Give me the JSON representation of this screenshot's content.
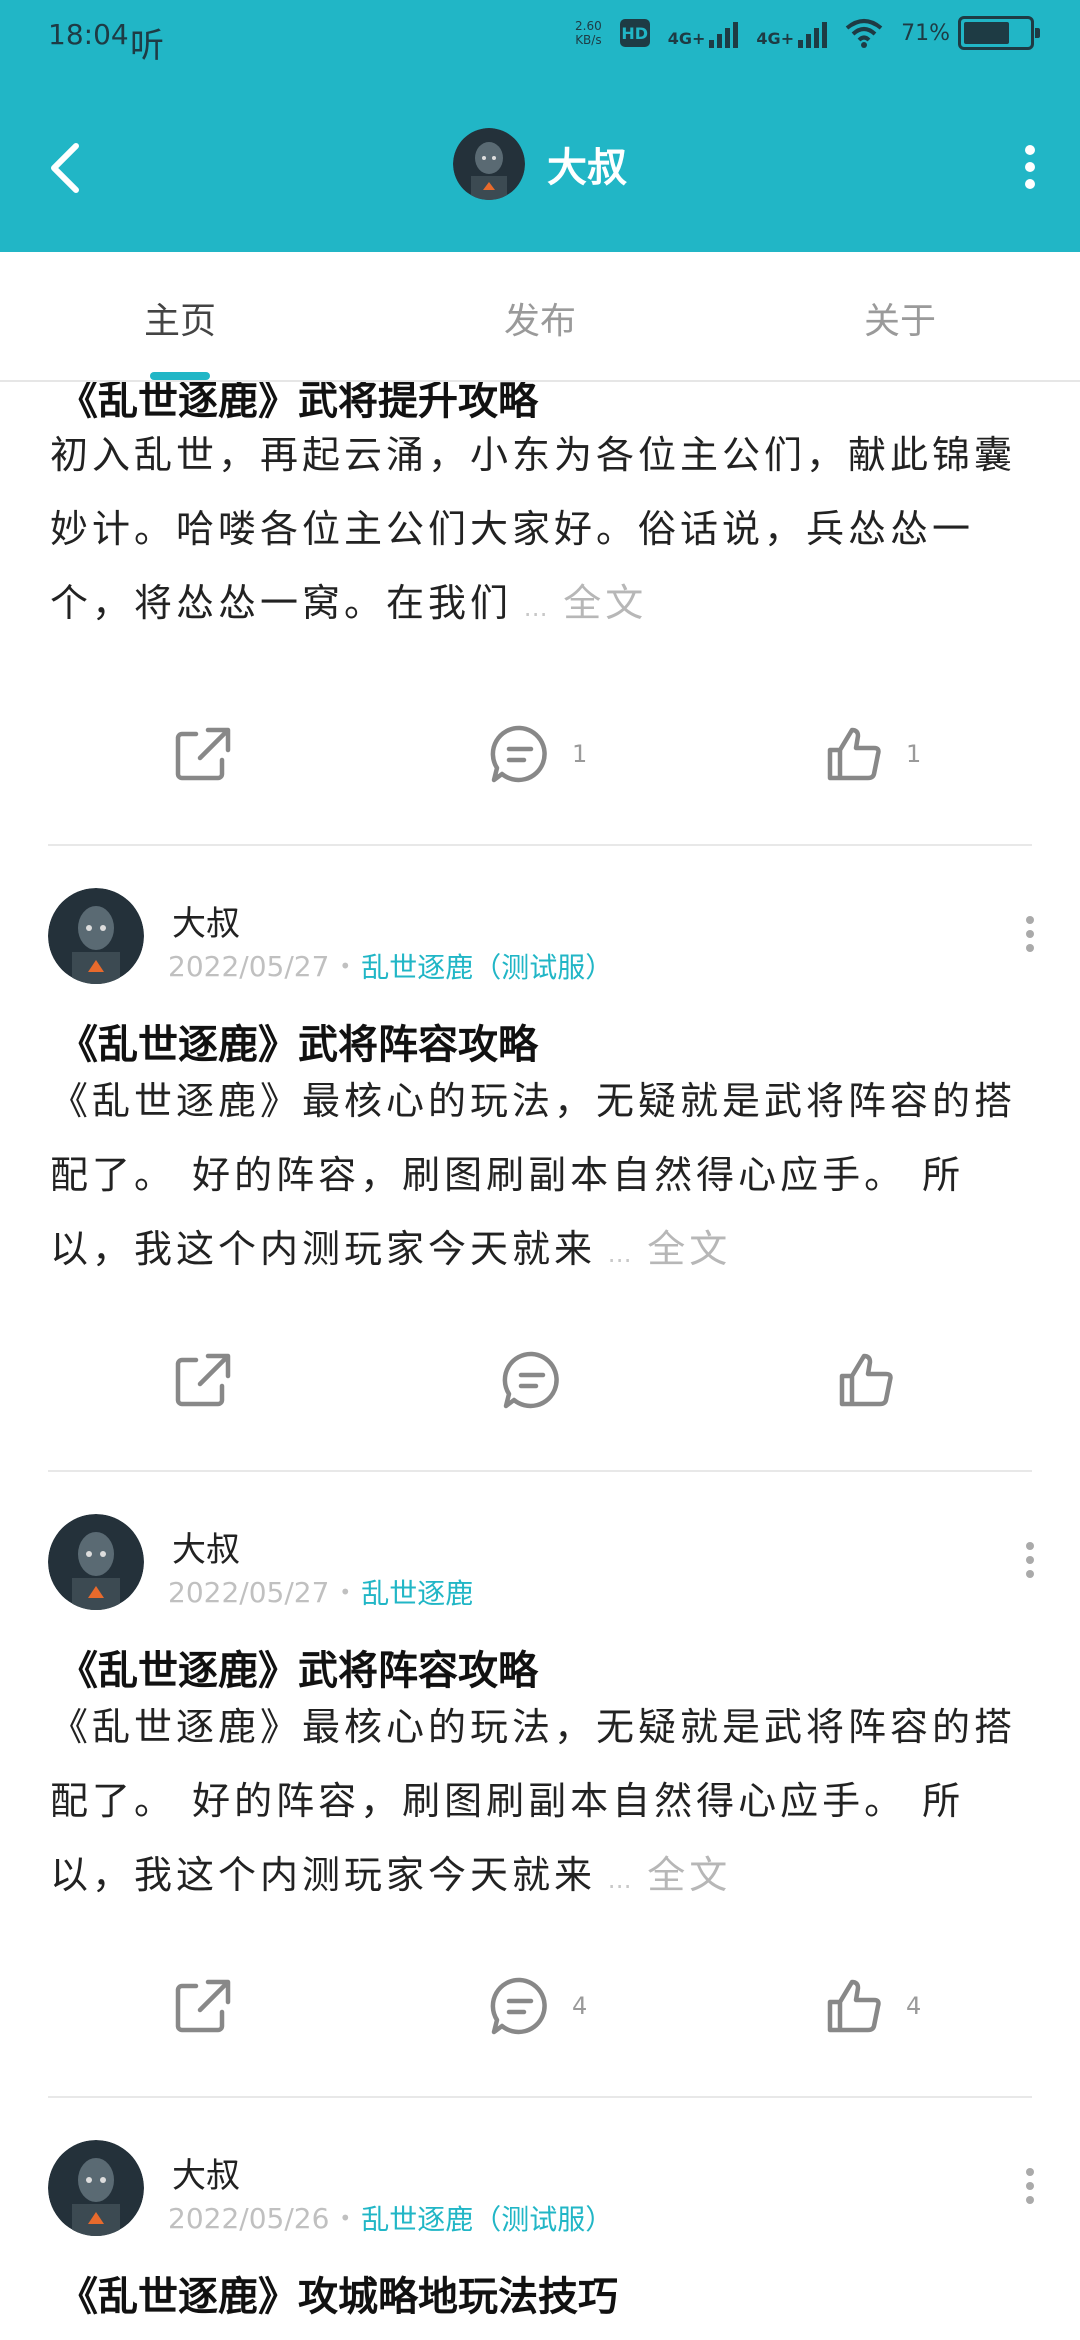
{
  "status_bar": {
    "time": "18:04",
    "listen": "听",
    "speed_top": "2.60",
    "speed_bottom": "KB/s",
    "hd": "HD",
    "net1": "4G+",
    "net2": "4G+",
    "battery": "71%"
  },
  "header": {
    "title": "大叔",
    "back_icon": "back-arrow-icon",
    "more_icon": "more-vertical-icon",
    "color": "#21b6c6"
  },
  "tabs": [
    {
      "label": "主页"
    },
    {
      "label": "发布"
    },
    {
      "label": "关于"
    }
  ],
  "posts": [
    {
      "title": "《乱世逐鹿》武将提升攻略",
      "body": "初入乱世，再起云涌，小东为各位主公们，献此锦囊妙计。哈喽各位主公们大家好。俗话说，兵怂怂一个，将怂怂一窝。在我们",
      "more": "全文",
      "comments": "1",
      "likes": "1"
    },
    {
      "author": "大叔",
      "date": "2022/05/27",
      "game": "乱世逐鹿（测试服）",
      "title": "《乱世逐鹿》武将阵容攻略",
      "body": "《乱世逐鹿》最核心的玩法，无疑就是武将阵容的搭配了。 好的阵容，刷图刷副本自然得心应手。 所以，我这个内测玩家今天就来",
      "more": "全文",
      "comments": "",
      "likes": ""
    },
    {
      "author": "大叔",
      "date": "2022/05/27",
      "game": "乱世逐鹿",
      "title": "《乱世逐鹿》武将阵容攻略",
      "body": "《乱世逐鹿》最核心的玩法，无疑就是武将阵容的搭配了。 好的阵容，刷图刷副本自然得心应手。 所以，我这个内测玩家今天就来",
      "more": "全文",
      "comments": "4",
      "likes": "4"
    },
    {
      "author": "大叔",
      "date": "2022/05/26",
      "game": "乱世逐鹿（测试服）",
      "title": "《乱世逐鹿》攻城略地玩法技巧"
    }
  ]
}
